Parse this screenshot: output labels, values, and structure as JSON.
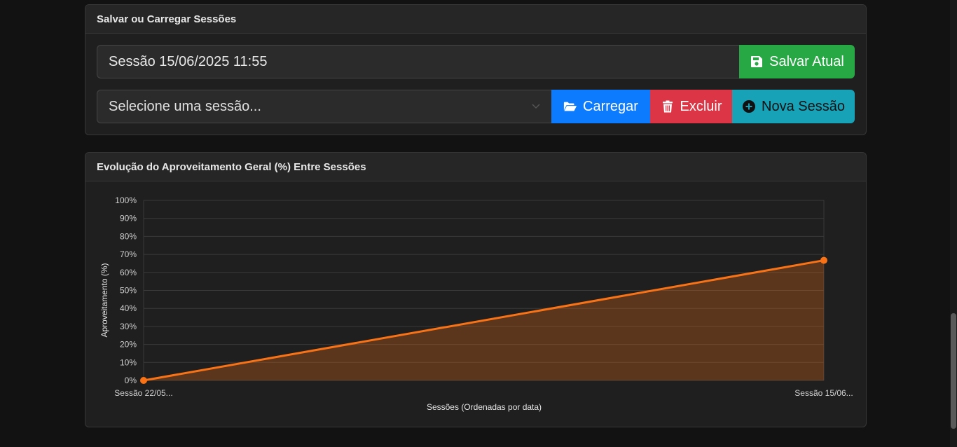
{
  "sessions_card": {
    "title": "Salvar ou Carregar Sessões",
    "session_name_value": "Sessão 15/06/2025 11:55",
    "save_label": "Salvar Atual",
    "select_placeholder": "Selecione uma sessão...",
    "load_label": "Carregar",
    "delete_label": "Excluir",
    "new_label": "Nova Sessão"
  },
  "chart_card": {
    "title": "Evolução do Aproveitamento Geral (%) Entre Sessões"
  },
  "icons": {
    "save": "floppy-disk-icon",
    "load": "folder-open-icon",
    "delete": "trash-icon",
    "new": "plus-circle-icon",
    "select": "chevron-down-icon"
  },
  "colors": {
    "success": "#28a745",
    "primary": "#0d7bfd",
    "danger": "#dc3545",
    "info": "#17a2b8",
    "line": "#f97316",
    "fill": "rgba(249,115,22,0.28)"
  },
  "chart_data": {
    "type": "area",
    "categories": [
      "Sessão 22/05...",
      "Sessão 15/06..."
    ],
    "series": [
      {
        "values": [
          0,
          66.7
        ]
      }
    ],
    "title": "",
    "xlabel": "Sessões (Ordenadas por data)",
    "ylabel": "Aproveitamento (%)",
    "ylim": [
      0,
      100
    ],
    "yticks": [
      "0%",
      "10%",
      "20%",
      "30%",
      "40%",
      "50%",
      "60%",
      "70%",
      "80%",
      "90%",
      "100%"
    ],
    "grid": true,
    "legend": "none"
  }
}
